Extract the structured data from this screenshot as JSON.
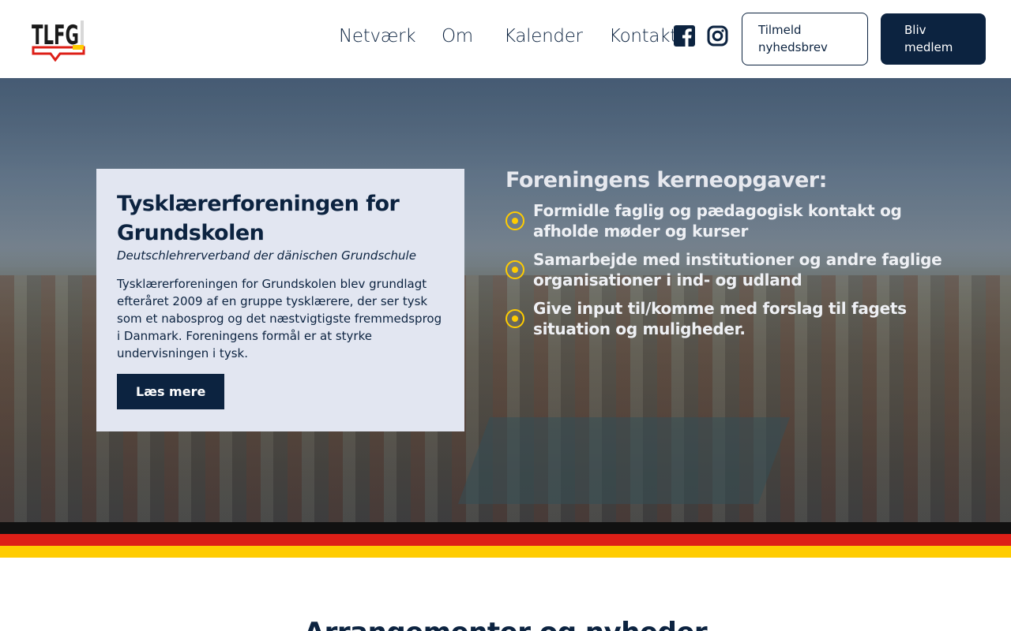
{
  "header": {
    "logo_text": "TLFG",
    "nav": [
      {
        "label": "Netværk"
      },
      {
        "label": "Om"
      },
      {
        "label": "Kalender"
      },
      {
        "label": "Kontakt"
      }
    ],
    "social": [
      {
        "icon": "facebook-icon"
      },
      {
        "icon": "instagram-icon"
      }
    ],
    "newsletter_button": "Tilmeld nyhedsbrev",
    "member_button": "Bliv medlem"
  },
  "hero": {
    "card": {
      "title": "Tysklærerforeningen for Grundskolen",
      "subtitle": "Deutschlehrerverband der dänischen Grundschule",
      "body": "Tysklærerforeningen for Grundskolen blev grundlagt efteråret 2009 af en gruppe tysklærere, der ser tysk som et nabosprog og det næstvigtigste fremmedsprog i Danmark. Foreningens formål er at styrke undervisningen i tysk.",
      "button": "Læs mere"
    },
    "tasks": {
      "title": "Foreningens kerneopgaver:",
      "items": [
        {
          "text": "Formidle faglig og pædagogisk kontakt og afholde møder og kurser"
        },
        {
          "text": "Samarbejde med institutioner og andre faglige organisationer i ind- og udland"
        },
        {
          "text": "Give input til/komme med forslag til fagets situation og muligheder."
        }
      ]
    }
  },
  "colors": {
    "navy": "#0c2340",
    "flag_black": "#111111",
    "flag_red": "#dd1f17",
    "flag_gold": "#ffcc00"
  },
  "section": {
    "title": "Arrangementer og nyheder"
  }
}
